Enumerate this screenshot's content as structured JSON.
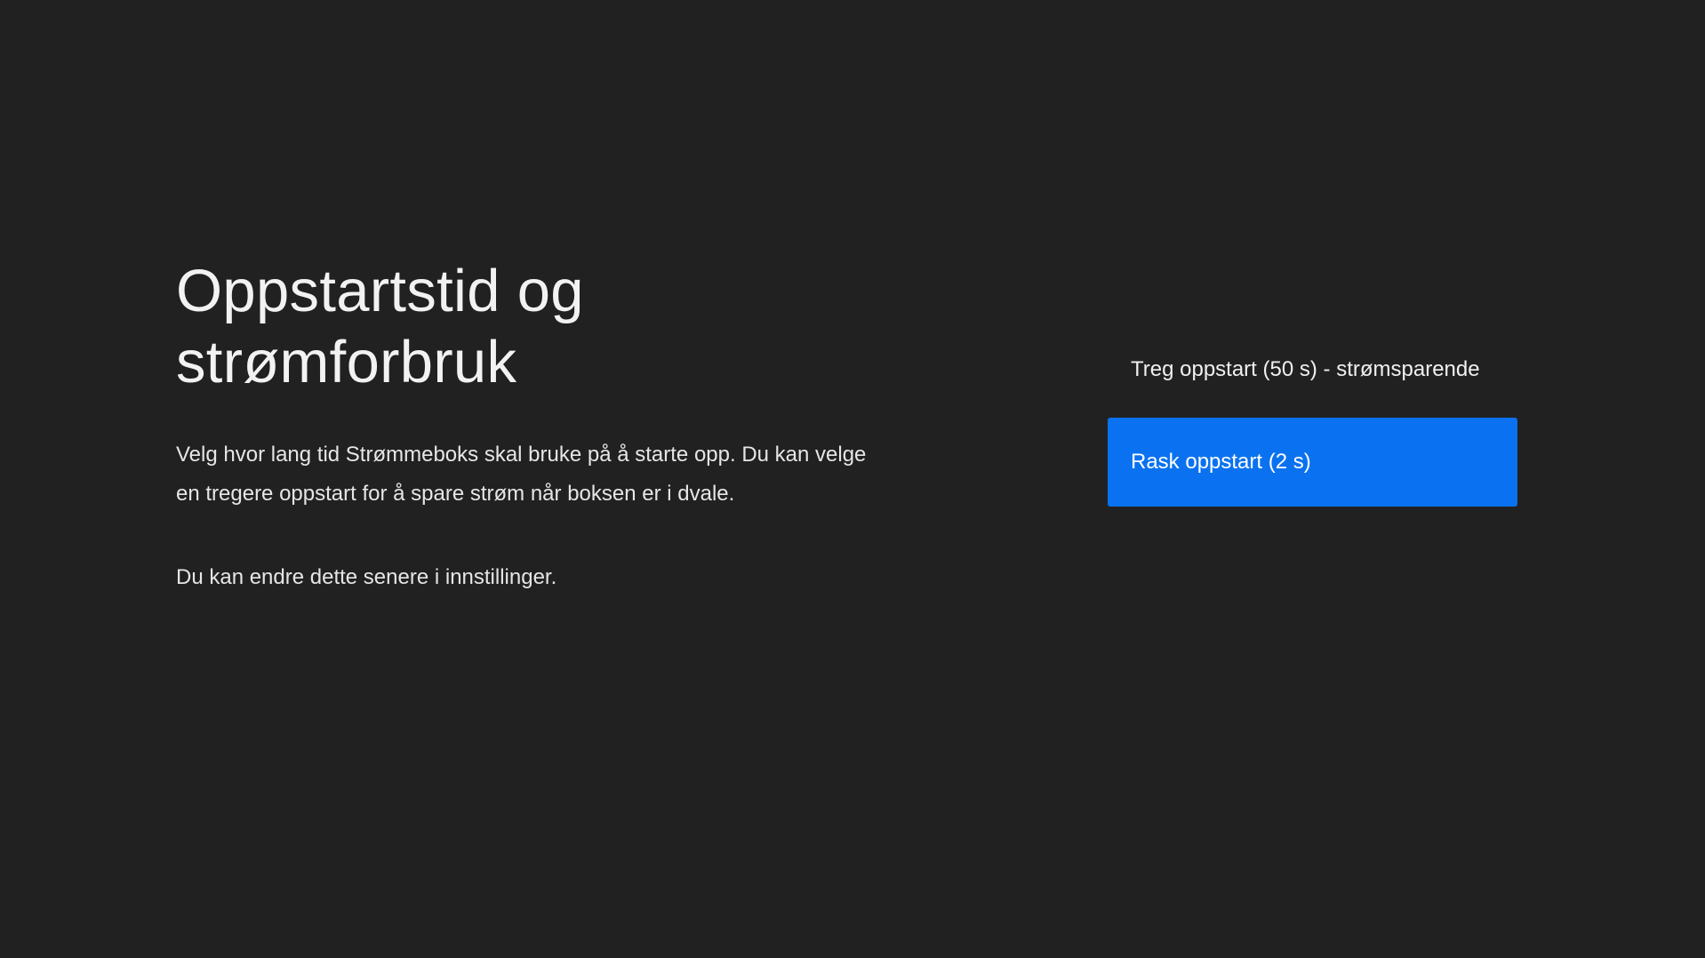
{
  "header": {
    "title": "Oppstartstid og strømforbruk"
  },
  "main": {
    "description": "Velg hvor lang tid Strømmeboks skal bruke på å starte opp. Du kan velge en tregere oppstart for å spare strøm når boksen er i dvale.",
    "note": "Du kan endre dette senere i innstillinger."
  },
  "options": [
    {
      "label": "Treg oppstart (50 s) - strømsparende",
      "selected": false
    },
    {
      "label": "Rask oppstart (2 s)",
      "selected": true
    }
  ],
  "colors": {
    "background": "#212121",
    "accent": "#0a72f0",
    "text": "#f2f2f2"
  }
}
